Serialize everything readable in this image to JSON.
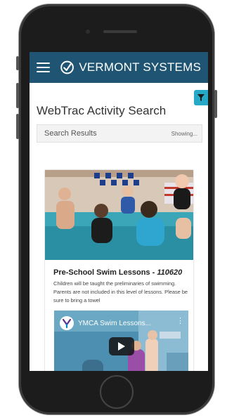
{
  "app": {
    "brand": "VERMONT SYSTEMS"
  },
  "page": {
    "title": "WebTrac Activity Search"
  },
  "results": {
    "label": "Search Results",
    "showing": "Showing..."
  },
  "card": {
    "title": "Pre-School Swim Lessons - ",
    "code": "110620",
    "description": "Children will be taught the preliminaries of swimming. Parents are not included in this level of lessons. Please be sure to bring a towel",
    "video": {
      "title": "YMCA Swim Lessons..."
    }
  },
  "colors": {
    "appbar": "#1f5572",
    "filter": "#26a9c6"
  },
  "icons": {
    "menu": "hamburger-icon",
    "filter": "filter-icon",
    "play": "play-icon",
    "more": "more-vertical-icon"
  }
}
